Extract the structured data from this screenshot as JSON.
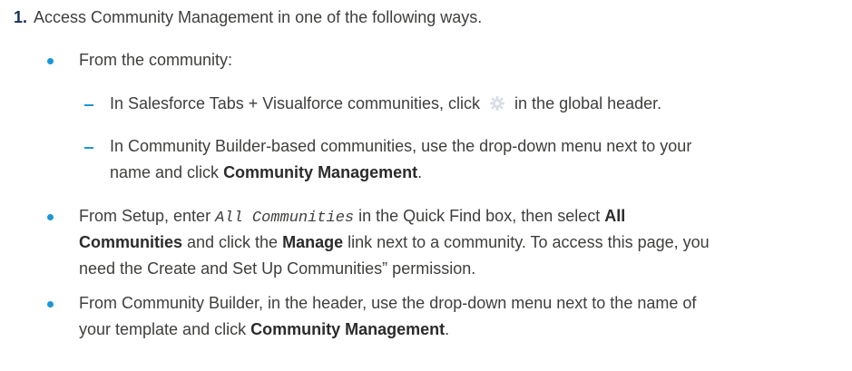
{
  "step": {
    "number": "1.",
    "text": "Access Community Management in one of the following ways."
  },
  "bullet1": {
    "text": "From the community:",
    "sub1": {
      "before_icon": "In Salesforce Tabs + Visualforce communities, click",
      "icon": "gear-icon",
      "after_icon": "in the global header."
    },
    "sub2": {
      "line1": "In Community Builder-based communities, use the drop-down menu next to your",
      "line2_before": "name and click ",
      "line2_bold": "Community Management",
      "line2_after": "."
    }
  },
  "bullet2": {
    "line1_before": "From Setup, enter ",
    "line1_code": "All Communities",
    "line1_after": " in the Quick Find box, then select ",
    "line1_bold": "All",
    "line2_bold1": "Communities",
    "line2_mid1": " and click the ",
    "line2_bold2": "Manage",
    "line2_after": " link next to a community. To access this page, you",
    "line3": "need the Create and Set Up Communities” permission."
  },
  "bullet3": {
    "line1": "From Community Builder, in the header, use the drop-down menu next to the name of",
    "line2_before": "your template and click ",
    "line2_bold": "Community Management",
    "line2_after": "."
  },
  "colors": {
    "accent": "#1b96d6",
    "text": "#3e3e3c",
    "step_number": "#16325c"
  }
}
